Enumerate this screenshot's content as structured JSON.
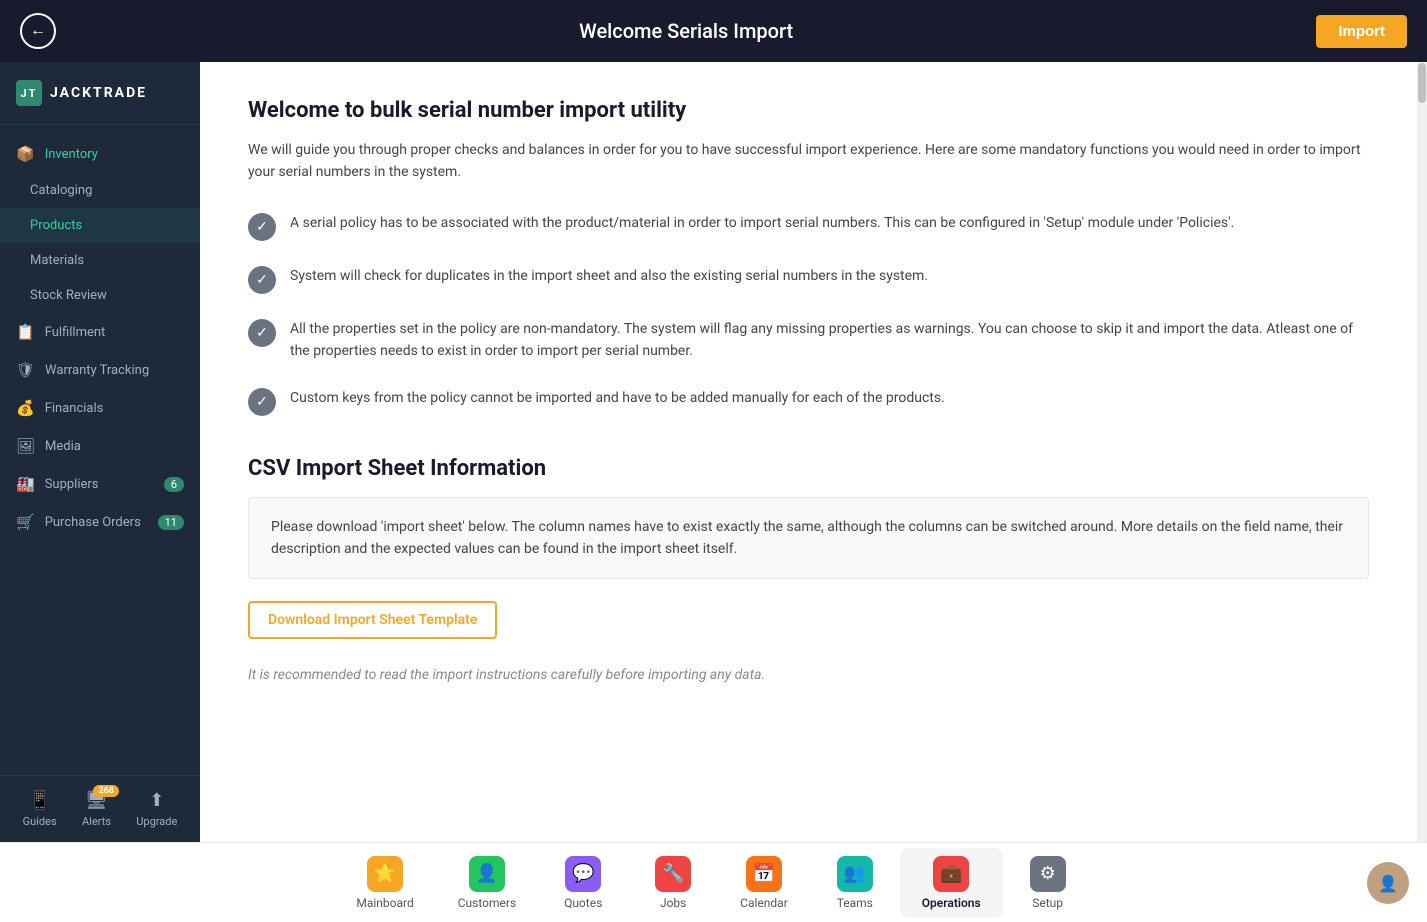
{
  "header": {
    "title": "Welcome Serials Import",
    "back_label": "←",
    "import_label": "Import"
  },
  "sidebar": {
    "logo": "JACKTRADE",
    "logo_abbr": "JT",
    "items": [
      {
        "id": "inventory",
        "label": "Inventory",
        "icon": "📦",
        "active": true
      },
      {
        "id": "cataloging",
        "label": "Cataloging",
        "icon": "",
        "sub": true
      },
      {
        "id": "products",
        "label": "Products",
        "icon": "",
        "sub": true,
        "active": true
      },
      {
        "id": "materials",
        "label": "Materials",
        "icon": "",
        "sub": true
      },
      {
        "id": "stock-review",
        "label": "Stock Review",
        "icon": "",
        "sub": true
      },
      {
        "id": "fulfillment",
        "label": "Fulfillment",
        "icon": "📋"
      },
      {
        "id": "warranty-tracking",
        "label": "Warranty Tracking",
        "icon": "🛡"
      },
      {
        "id": "financials",
        "label": "Financials",
        "icon": "💰"
      },
      {
        "id": "media",
        "label": "Media",
        "icon": "🖼"
      },
      {
        "id": "suppliers",
        "label": "Suppliers",
        "icon": "🏭",
        "badge": "6"
      },
      {
        "id": "purchase-orders",
        "label": "Purchase Orders",
        "icon": "🛒",
        "badge": "11"
      }
    ],
    "footer": [
      {
        "id": "guides",
        "label": "Guides",
        "icon": "📱"
      },
      {
        "id": "alerts",
        "label": "Alerts",
        "icon": "🖥",
        "badge": "268"
      },
      {
        "id": "upgrade",
        "label": "Upgrade",
        "icon": "⬆"
      }
    ]
  },
  "content": {
    "heading1": "Welcome to bulk serial number import utility",
    "intro": "We will guide you through proper checks and balances in order for you to have successful import experience. Here are some mandatory functions you would need in order to import your serial numbers in the system.",
    "checklist": [
      {
        "text": "A serial policy has to be associated with the product/material in order to import serial numbers. This can be configured in 'Setup' module under 'Policies'."
      },
      {
        "text": "System will check for duplicates in the import sheet and also the existing serial numbers in the system."
      },
      {
        "text": "All the properties set in the policy are non-mandatory. The system will flag any missing properties as warnings. You can choose to skip it and import the data. Atleast one of the properties needs to exist in order to import per serial number."
      },
      {
        "text": "Custom keys from the policy cannot be imported and have to be added manually for each of the products."
      }
    ],
    "csv_heading": "CSV Import Sheet Information",
    "csv_desc": "Please download 'import sheet' below. The column names have to exist exactly the same, although the columns can be switched around. More details on the field name, their description and the expected values can be found in the import sheet itself.",
    "download_label": "Download Import Sheet Template",
    "scroll_hint": "It is recommended to read the import instructions carefully before importing any data."
  },
  "bottom_nav": [
    {
      "id": "mainboard",
      "label": "Mainboard",
      "icon": "⭐",
      "color": "#f5a623"
    },
    {
      "id": "customers",
      "label": "Customers",
      "icon": "👤",
      "color": "#22c55e"
    },
    {
      "id": "quotes",
      "label": "Quotes",
      "icon": "💬",
      "color": "#8b5cf6"
    },
    {
      "id": "jobs",
      "label": "Jobs",
      "icon": "🔧",
      "color": "#ef4444"
    },
    {
      "id": "calendar",
      "label": "Calendar",
      "icon": "📅",
      "color": "#f97316"
    },
    {
      "id": "teams",
      "label": "Teams",
      "icon": "👥",
      "color": "#14b8a6"
    },
    {
      "id": "operations",
      "label": "Operations",
      "icon": "💼",
      "color": "#ef4444",
      "active": true
    },
    {
      "id": "setup",
      "label": "Setup",
      "icon": "⚙",
      "color": "#6b7280"
    }
  ]
}
